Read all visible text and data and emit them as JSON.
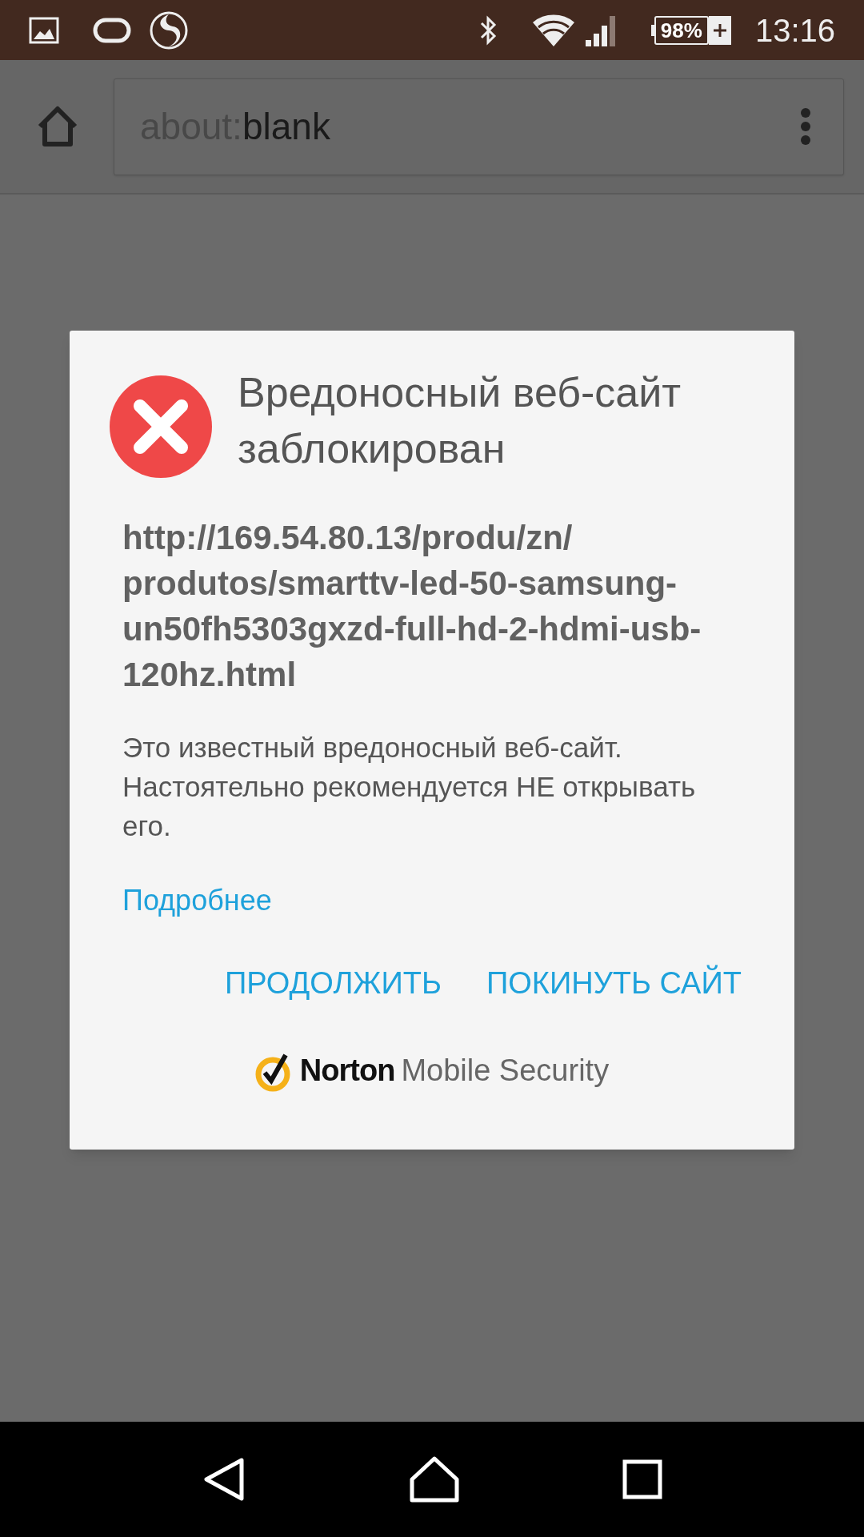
{
  "status_bar": {
    "battery": "98%",
    "time": "13:16"
  },
  "browser": {
    "address": {
      "scheme": "about:",
      "path": "blank"
    }
  },
  "dialog": {
    "title": "Вредоносный веб-сайт заблокирован",
    "url": "http://169.54.80.13/produ/zn/produtos/smarttv-led-50-samsung-un50fh5303gxzd-full-hd-2-hdmi-usb-120hz.html",
    "message": "Это известный вредоносный веб-сайт. Настоятельно рекомендуется НЕ открывать его.",
    "link": "Подробнее",
    "buttons": [
      "ПРОДОЛЖИТЬ",
      "ПОКИНУТЬ САЙТ"
    ],
    "footer": {
      "brand": "Norton",
      "product": "Mobile Security"
    }
  }
}
